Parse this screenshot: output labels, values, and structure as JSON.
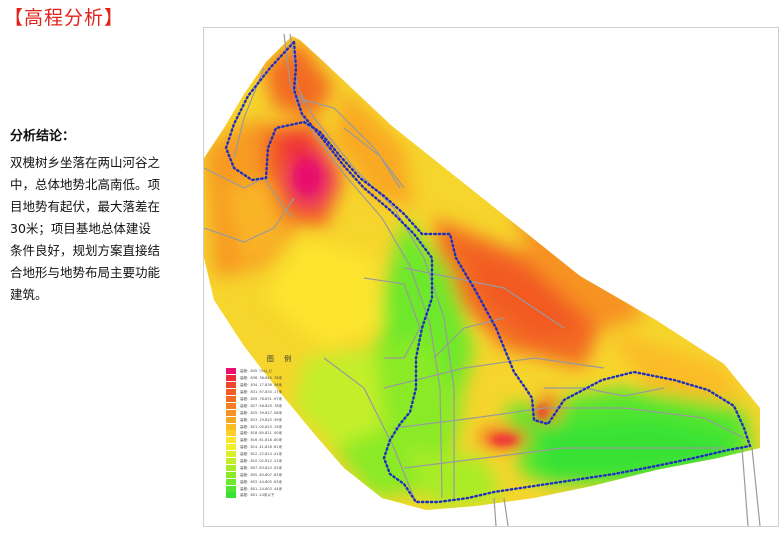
{
  "page": {
    "title": "【高程分析】"
  },
  "analysis": {
    "heading": "分析结论：",
    "body": "双槐树乡坐落在两山河谷之中，总体地势北高南低。项目地势有起伏，最大落差在30米；项目基地总体建设条件良好，规划方案直接结合地形与地势布局主要功能建筑。"
  },
  "map": {
    "legend_title": "图 例",
    "legend": [
      {
        "label": "高程：845（%以上）",
        "color": "#e8106c"
      },
      {
        "label": "高程：836 .36-845 .78米",
        "color": "#ef2a3a"
      },
      {
        "label": "高程：834 .17-836 .36米",
        "color": "#f0442c"
      },
      {
        "label": "高程：831 .97-834 .17米",
        "color": "#f25a24"
      },
      {
        "label": "高程：829 .78-831 .97米",
        "color": "#f36b22"
      },
      {
        "label": "高程：827 .58-829 .78米",
        "color": "#f57f22"
      },
      {
        "label": "高程：825 .39-827 .58米",
        "color": "#f79322"
      },
      {
        "label": "高程：823 .19-825 .39米",
        "color": "#f9a824"
      },
      {
        "label": "高程：821 .00-823 .19米",
        "color": "#fbbc26"
      },
      {
        "label": "高程：818 .80-821 .00米",
        "color": "#fdd12a"
      },
      {
        "label": "高程：816 .61-818 .80米",
        "color": "#fde52e"
      },
      {
        "label": "高程：814 .41-816 .61米",
        "color": "#f2ee2e"
      },
      {
        "label": "高程：812 .22-814 .41米",
        "color": "#dcef2c"
      },
      {
        "label": "高程：810 .02-812 .22米",
        "color": "#c4ee2a"
      },
      {
        "label": "高程：807 .83-810 .02米",
        "color": "#a8ec28"
      },
      {
        "label": "高程：805 .63-807 .83米",
        "color": "#8aea28"
      },
      {
        "label": "高程：803 .44-805 .63米",
        "color": "#6ee82a"
      },
      {
        "label": "高程：801 .24-803 .44米",
        "color": "#52e62e"
      },
      {
        "label": "高程：801 .24米以下",
        "color": "#38e234"
      }
    ]
  }
}
